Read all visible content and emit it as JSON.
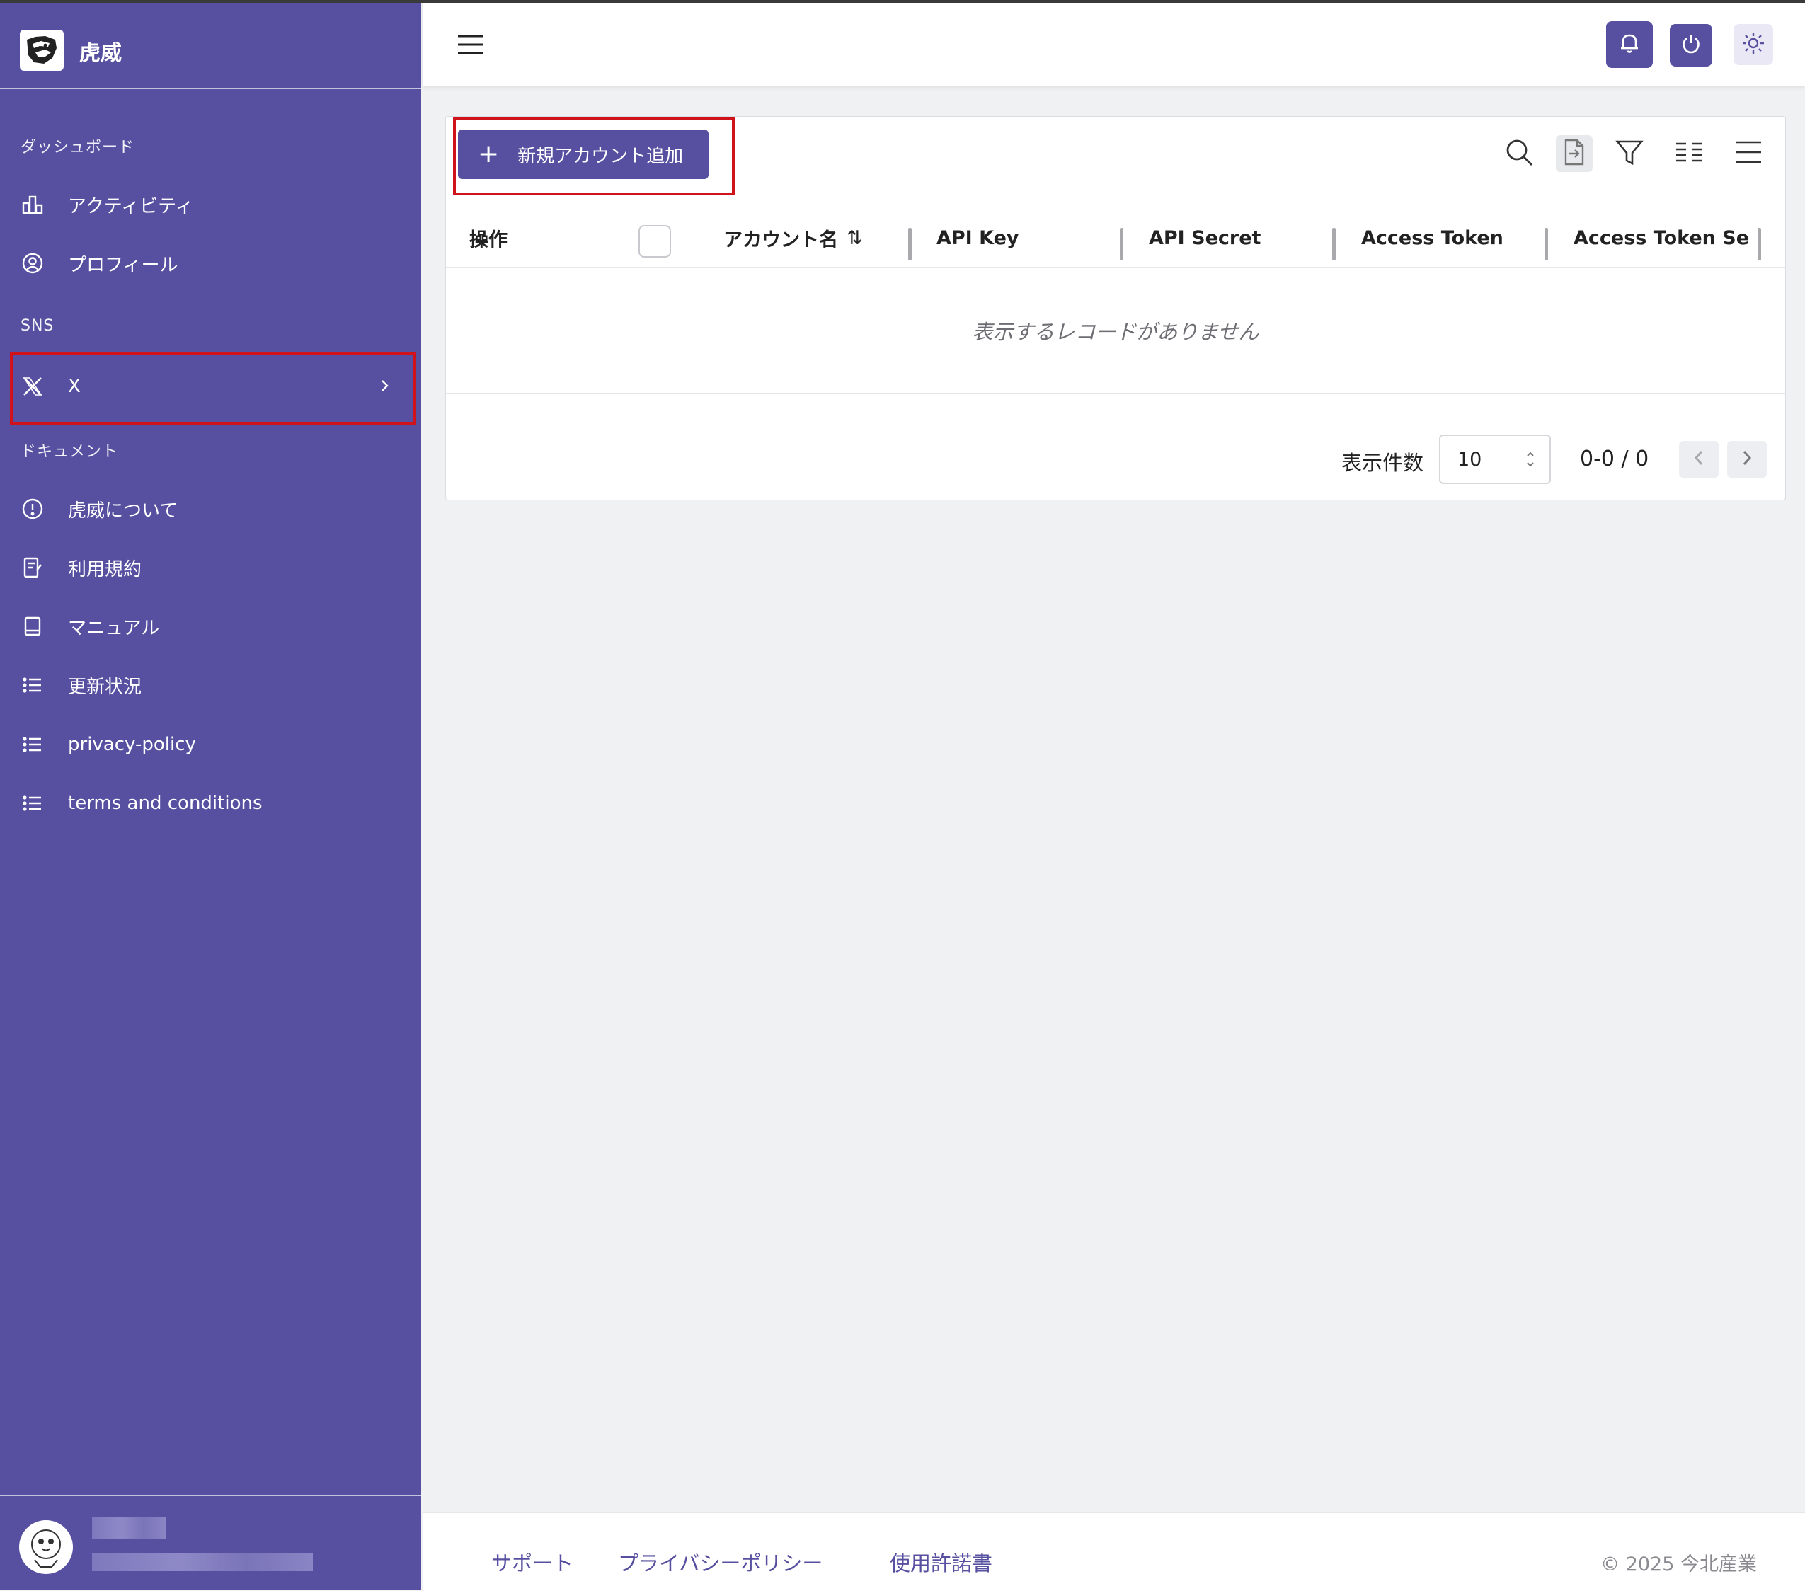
{
  "app": {
    "name": "虎威"
  },
  "sidebar": {
    "sections": {
      "dashboard": "ダッシュボード",
      "sns": "SNS",
      "docs": "ドキュメント"
    },
    "items": [
      {
        "label": "アクティビティ",
        "icon": "bar-chart-icon"
      },
      {
        "label": "プロフィール",
        "icon": "user-circle-icon"
      },
      {
        "label": "X",
        "icon": "x-logo-icon",
        "highlighted": true,
        "has_submenu": true
      },
      {
        "label": "虎威について",
        "icon": "info-circle-icon"
      },
      {
        "label": "利用規約",
        "icon": "document-pen-icon"
      },
      {
        "label": "マニュアル",
        "icon": "book-icon"
      },
      {
        "label": "更新状況",
        "icon": "list-icon"
      },
      {
        "label": "privacy-policy",
        "icon": "list-icon"
      },
      {
        "label": "terms and conditions",
        "icon": "list-icon"
      }
    ]
  },
  "header": {
    "buttons": [
      "bell-icon",
      "power-icon",
      "sun-icon"
    ]
  },
  "toolbar": {
    "add_button": "新規アカウント追加",
    "icons": [
      "search-icon",
      "export-file-icon",
      "filter-icon",
      "columns-icon",
      "menu-icon"
    ]
  },
  "table": {
    "columns": [
      "操作",
      "アカウント名",
      "API Key",
      "API Secret",
      "Access Token",
      "Access Token Se"
    ],
    "sortable_indicator": "⇅",
    "empty_message": "表示するレコードがありません"
  },
  "pagination": {
    "per_page_label": "表示件数",
    "per_page_value": "10",
    "range": "0-0 / 0"
  },
  "footer": {
    "links": [
      "サポート",
      "プライバシーポリシー",
      "使用許諾書"
    ],
    "copyright": "© 2025 今北産業"
  },
  "colors": {
    "sidebar_bg": "#5750a1",
    "accent": "#5750a1",
    "highlight_border": "#d0121b",
    "page_bg": "#f0f1f3"
  }
}
